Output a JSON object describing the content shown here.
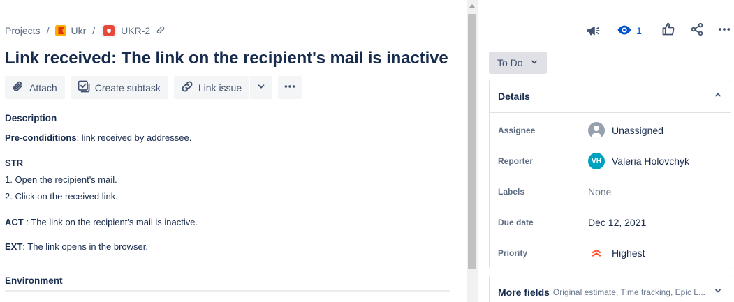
{
  "breadcrumb": {
    "projects": "Projects",
    "separator": "/",
    "project": "Ukr",
    "issue_key": "UKR-2"
  },
  "issue": {
    "title": "Link received: The link on the recipient's mail is inactive"
  },
  "toolbar": {
    "attach": "Attach",
    "create_subtask": "Create subtask",
    "link_issue": "Link issue"
  },
  "description": {
    "heading": "Description",
    "pre_label": "Pre-condiditions",
    "pre_text": ":  link received by addressee.",
    "str_label": "STR",
    "step1": "1. Open the recipient's mail.",
    "step2": "2. Click on the received link.",
    "act_label": "ACT",
    "act_text": " : The link on the recipient's mail is inactive.",
    "ext_label": "EXT",
    "ext_text": ": The link opens in the browser."
  },
  "environment": {
    "heading": "Environment"
  },
  "top_actions": {
    "watch_count": "1"
  },
  "status": {
    "label": "To Do"
  },
  "details": {
    "heading": "Details",
    "assignee_label": "Assignee",
    "assignee_value": "Unassigned",
    "reporter_label": "Reporter",
    "reporter_initials": "VH",
    "reporter_value": "Valeria Holovchyk",
    "labels_label": "Labels",
    "labels_value": "None",
    "due_label": "Due date",
    "due_value": "Dec 12, 2021",
    "priority_label": "Priority",
    "priority_value": "Highest"
  },
  "more_fields": {
    "title": "More fields",
    "summary": "Original estimate, Time tracking, Epic L..."
  },
  "colors": {
    "accent": "#0052cc",
    "priority_highest": "#ff5630",
    "status_bg": "#dfe1e6",
    "avatar_reporter": "#00a3bf"
  }
}
